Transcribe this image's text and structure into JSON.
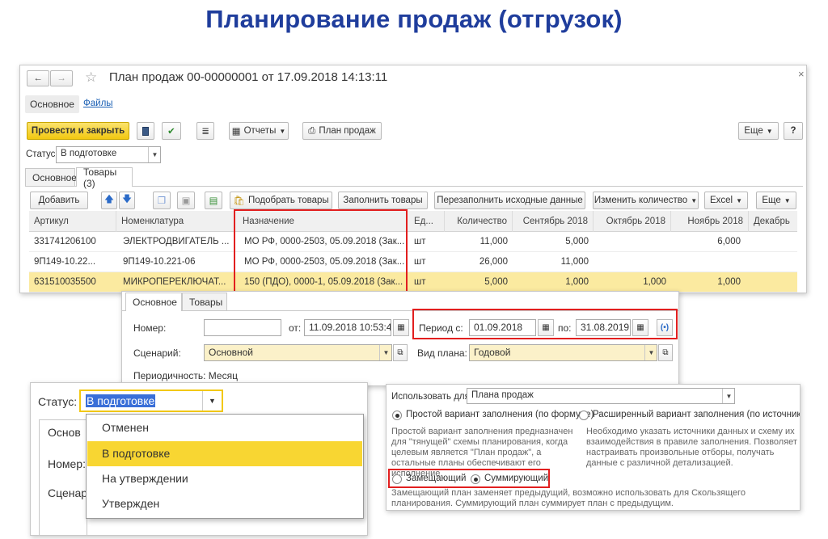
{
  "slide_title": "Планирование продаж (отгрузок)",
  "main_window": {
    "title": "План продаж 00-00000001 от 17.09.2018 14:13:11",
    "close": "×",
    "top_tabs": [
      "Основное",
      "Файлы"
    ],
    "toolbar": {
      "post_close": "Провести и закрыть",
      "reports": "Отчеты",
      "sales_plan": "План продаж",
      "more": "Еще",
      "help": "?"
    },
    "status_label": "Статус:",
    "status_value": "В подготовке",
    "doc_tabs": [
      "Основное",
      "Товары (3)"
    ],
    "grid_toolbar": {
      "add": "Добавить",
      "pick": "Подобрать товары",
      "fill": "Заполнить товары",
      "refill": "Перезаполнить исходные данные",
      "change_qty": "Изменить количество",
      "excel": "Excel",
      "more": "Еще"
    },
    "columns": [
      "Артикул",
      "Номенклатура",
      "Назначение",
      "Ед...",
      "Количество",
      "Сентябрь 2018",
      "Октябрь 2018",
      "Ноябрь 2018",
      "Декабрь"
    ],
    "rows": [
      {
        "art": "331741206100",
        "nom": "ЭЛЕКТРОДВИГАТЕЛЬ ...",
        "dest": "МО РФ, 0000-2503, 05.09.2018 (Зак...",
        "unit": "шт",
        "qty": "11,000",
        "sep": "5,000",
        "oct": "",
        "nov": "6,000"
      },
      {
        "art": "9П149-10.22...",
        "nom": "9П149-10.221-06",
        "dest": "МО РФ, 0000-2503, 05.09.2018 (Зак...",
        "unit": "шт",
        "qty": "26,000",
        "sep": "11,000",
        "oct": "",
        "nov": ""
      },
      {
        "art": "631510035500",
        "nom": "МИКРОПЕРЕКЛЮЧАТ...",
        "dest": "150 (ПДО), 0000-1, 05.09.2018 (Зак...",
        "unit": "шт",
        "qty": "5,000",
        "sep": "1,000",
        "oct": "1,000",
        "nov": "1,000"
      }
    ]
  },
  "header_panel": {
    "tabs": [
      "Основное",
      "Товары"
    ],
    "number_label": "Номер:",
    "number_value": "",
    "from_label": "от:",
    "from_value": "11.09.2018 10:53:45",
    "period_label": "Период с:",
    "period_from": "01.09.2018",
    "period_to_label": "по:",
    "period_to": "31.08.2019",
    "scenario_label": "Сценарий:",
    "scenario_value": "Основной",
    "plan_type_label": "Вид плана:",
    "plan_type_value": "Годовой",
    "periodicity": "Периодичность: Месяц"
  },
  "status_dropdown": {
    "label": "Статус:",
    "value": "В подготовке",
    "behind_labels": [
      "Основ",
      "Номер:",
      "Сценар"
    ],
    "options": [
      "Отменен",
      "В подготовке",
      "На утверждении",
      "Утвержден"
    ],
    "selected_index": 1
  },
  "fill_panel": {
    "use_for_label": "Использовать для:",
    "use_for_value": "Плана продаж",
    "option_simple": "Простой вариант заполнения (по формуле)",
    "option_extended": "Расширенный вариант заполнения (по источникам)",
    "note_simple": "Простой вариант заполнения предназначен для \"тянущей\" схемы планирования, когда целевым является \"План продаж\", а остальные планы обеспечивают его исполнение.",
    "note_extended": "Необходимо указать источники данных и схему их взаимодействия в правиле заполнения. Позволяет настраивать произвольные отборы, получать данные с различной детализацией.",
    "mode_replace": "Замещающий",
    "mode_sum": "Суммирующий",
    "note_modes": "Замещающий план заменяет предыдущий, возможно использовать для Скользящего планирования. Суммирующий план суммирует план с предыдущим."
  }
}
